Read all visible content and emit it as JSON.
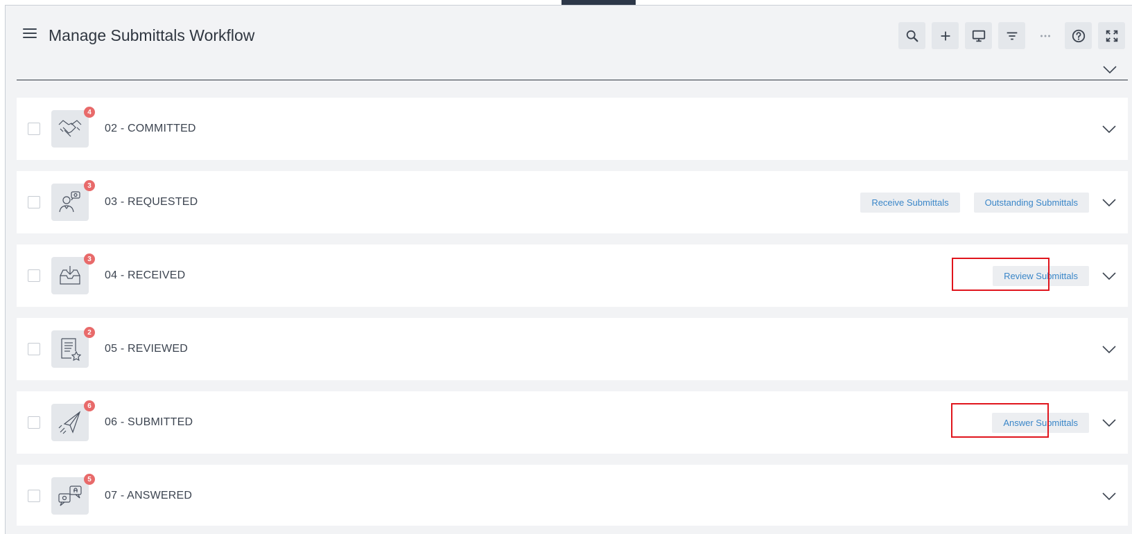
{
  "header": {
    "title": "Manage Submittals Workflow",
    "toolbar": [
      {
        "name": "search-button",
        "icon": "search-icon"
      },
      {
        "name": "add-button",
        "icon": "plus-icon"
      },
      {
        "name": "display-button",
        "icon": "monitor-icon"
      },
      {
        "name": "filter-button",
        "icon": "filter-icon"
      },
      {
        "name": "more-button",
        "icon": "more-icon"
      },
      {
        "name": "help-button",
        "icon": "help-icon"
      },
      {
        "name": "fullscreen-button",
        "icon": "expand-icon"
      }
    ]
  },
  "rows": [
    {
      "label": "02 - COMMITTED",
      "badge": "4",
      "icon": "handshake-icon",
      "actions": []
    },
    {
      "label": "03 - REQUESTED",
      "badge": "3",
      "icon": "person-chat-icon",
      "actions": [
        "Receive Submittals",
        "Outstanding Submittals"
      ]
    },
    {
      "label": "04 - RECEIVED",
      "badge": "3",
      "icon": "inbox-tray-icon",
      "actions": [
        "Review Submittals"
      ]
    },
    {
      "label": "05 - REVIEWED",
      "badge": "2",
      "icon": "document-star-icon",
      "actions": []
    },
    {
      "label": "06 - SUBMITTED",
      "badge": "6",
      "icon": "paper-plane-icon",
      "actions": [
        "Answer Submittals"
      ]
    },
    {
      "label": "07 - ANSWERED",
      "badge": "5",
      "icon": "speech-bubbles-icon",
      "actions": []
    }
  ],
  "colors": {
    "badge": "#e86a6a",
    "action_text": "#3a86c8",
    "highlight": "#e0141c"
  }
}
